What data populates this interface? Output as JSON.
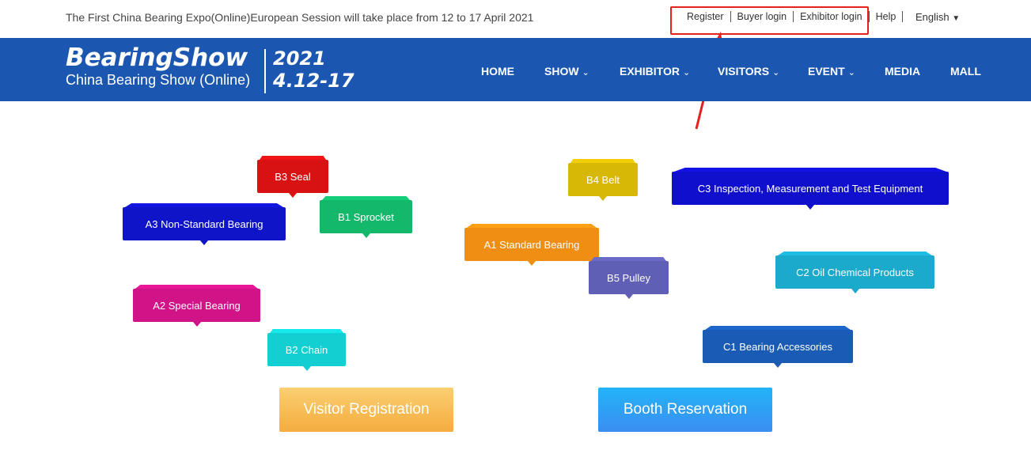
{
  "topbar": {
    "announcement": "The First China Bearing Expo(Online)European Session will take place from 12 to 17 April 2021",
    "links": [
      "Register",
      "Buyer login",
      "Exhibitor login",
      "Help"
    ],
    "language": "English"
  },
  "header": {
    "logo_brand": "BearingShow",
    "logo_sub": "China Bearing Show (Online)",
    "year": "2021",
    "dates": "4.12-17",
    "nav": [
      {
        "label": "HOME"
      },
      {
        "label": "SHOW"
      },
      {
        "label": "EXHIBITOR"
      },
      {
        "label": "VISITORS"
      },
      {
        "label": "EVENT"
      },
      {
        "label": "MEDIA"
      },
      {
        "label": "MALL"
      }
    ]
  },
  "tags": [
    {
      "label": "B3 Seal",
      "color": "#d81212"
    },
    {
      "label": "B1 Sprocket",
      "color": "#13b86a"
    },
    {
      "label": "A3 Non-Standard Bearing",
      "color": "#0f14c8"
    },
    {
      "label": "A2 Special Bearing",
      "color": "#d01488"
    },
    {
      "label": "B2 Chain",
      "color": "#14cfd2"
    },
    {
      "label": "B4 Belt",
      "color": "#d8b806"
    },
    {
      "label": "A1 Standard Bearing",
      "color": "#ef8e12"
    },
    {
      "label": "B5 Pulley",
      "color": "#5f5fb5"
    },
    {
      "label": "C3 Inspection, Measurement and Test Equipment",
      "color": "#1010cc"
    },
    {
      "label": "C2 Oil Chemical Products",
      "color": "#1ba9cc"
    },
    {
      "label": "C1 Bearing Accessories",
      "color": "#1a5bb5"
    }
  ],
  "cta": {
    "visitor": "Visitor Registration",
    "booth": "Booth Reservation"
  },
  "colors": {
    "header_bg": "#1b57b0",
    "annotation_red": "#e8201c"
  }
}
